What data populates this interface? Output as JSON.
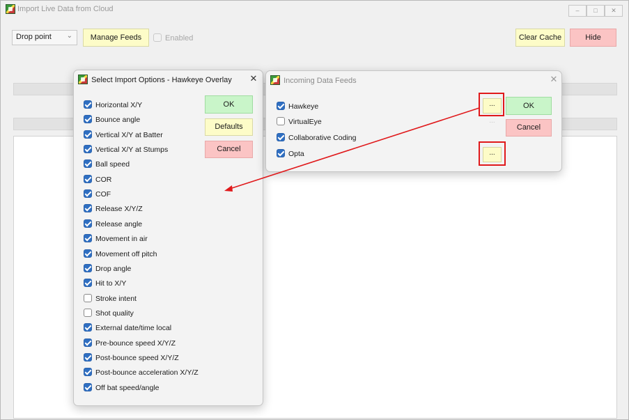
{
  "main_window": {
    "title": "Import Live Data from Cloud",
    "controls": {
      "minimize": "–",
      "maximize": "□",
      "close": "✕"
    },
    "view_select": {
      "value": "Drop point"
    },
    "manage_feeds_label": "Manage Feeds",
    "enabled_label": "Enabled",
    "enabled_checked": false,
    "clear_cache_label": "Clear Cache",
    "hide_label": "Hide"
  },
  "import_options_dialog": {
    "title": "Select Import Options - Hawkeye Overlay",
    "close": "✕",
    "ok_label": "OK",
    "defaults_label": "Defaults",
    "cancel_label": "Cancel",
    "options": [
      {
        "label": "Horizontal X/Y",
        "checked": true
      },
      {
        "label": "Bounce angle",
        "checked": true
      },
      {
        "label": "Vertical X/Y at Batter",
        "checked": true
      },
      {
        "label": "Vertical X/Y at Stumps",
        "checked": true
      },
      {
        "label": "Ball speed",
        "checked": true
      },
      {
        "label": "COR",
        "checked": true
      },
      {
        "label": "COF",
        "checked": true
      },
      {
        "label": "Release X/Y/Z",
        "checked": true
      },
      {
        "label": "Release angle",
        "checked": true
      },
      {
        "label": "Movement in air",
        "checked": true
      },
      {
        "label": "Movement off pitch",
        "checked": true
      },
      {
        "label": "Drop angle",
        "checked": true
      },
      {
        "label": "Hit to X/Y",
        "checked": true
      },
      {
        "label": "Stroke intent",
        "checked": false
      },
      {
        "label": "Shot quality",
        "checked": false
      },
      {
        "label": "External date/time local",
        "checked": true
      },
      {
        "label": "Pre-bounce speed X/Y/Z",
        "checked": true
      },
      {
        "label": "Post-bounce speed X/Y/Z",
        "checked": true
      },
      {
        "label": "Post-bounce acceleration X/Y/Z",
        "checked": true
      },
      {
        "label": "Off bat speed/angle",
        "checked": true
      }
    ]
  },
  "incoming_feeds_dialog": {
    "title": "Incoming Data Feeds",
    "close": "✕",
    "ok_label": "OK",
    "cancel_label": "Cancel",
    "feeds": [
      {
        "label": "Hawkeye",
        "checked": true,
        "config_label": "..."
      },
      {
        "label": "VirtualEye",
        "checked": false,
        "config_label": "..."
      },
      {
        "label": "Collaborative Coding",
        "checked": true,
        "config_label": ""
      },
      {
        "label": "Opta",
        "checked": true,
        "config_label": "..."
      }
    ]
  },
  "annotation": {
    "color": "#e0191b"
  }
}
